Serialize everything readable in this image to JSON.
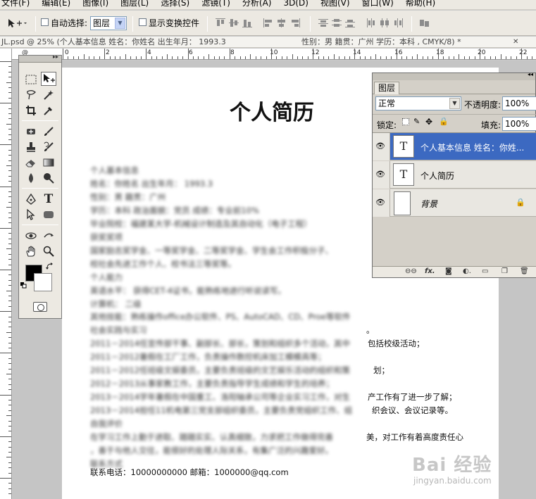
{
  "menu": [
    "文件(F)",
    "编辑(E)",
    "图像(I)",
    "图层(L)",
    "选择(S)",
    "滤镜(T)",
    "分析(A)",
    "3D(D)",
    "视图(V)",
    "窗口(W)",
    "帮助(H)"
  ],
  "options": {
    "auto_select_label": "自动选择:",
    "auto_select_value": "图层",
    "show_transform_label": "显示变换控件"
  },
  "doc": {
    "title": "JL.psd @ 25% (个人基本信息 姓名：你姓名  出生年月： 1993.3",
    "title_mid": "性别：男     籍贯：广州  学历：本科 , CMYK/8) *",
    "close": "✕"
  },
  "ruler": {
    "top_numbers": [
      "0",
      "2",
      "4",
      "6",
      "8",
      "10",
      "12",
      "14",
      "16",
      "18",
      "20",
      "22"
    ],
    "top_at_label": "@"
  },
  "resume": {
    "title": "个人简历",
    "lines": [
      "个人基本信息",
      "姓名：你姓名  出生年月： 1993.3",
      "性别：男     籍贯：广州",
      "学历：本科    政治面貌：党员    成绩：专业前10%",
      "毕业院校：福建某大学-机械设计制造及其自动化（电子工程）",
      "获奖奖项",
      "国家励志奖学金、一等奖学金、二等奖学金、学生会工作积极分子、",
      "校社会先进工作个人、校书法三等奖等。",
      "个人能力",
      "英语水平：  获得CET-4证书，能熟练地进行听说读写。",
      "计算机：  二级",
      "其他技能：熟练操作office办公软件、PS、AutoCAD、CD、Proe等软件",
      "社会实践与实习",
      "2011－2014任宣传部干事、副部长、部长，策划和组织多个活动，其中",
      "2011－2012暑假在工厂工作，负责操作数控机床加工模模具等；",
      "2011－2012任班级文娱委员，主要负责班级的文艺娱乐活动的组织和策",
      "2012－2013从事家教工作，主要负责指导学生成绩和学生的培养；",
      "2013－2014学年暑假在中国重工、洛阳轴承公司等企业实习工作，对生",
      "2013－2014担任11机电第三党支部组织委员，主要负责党组织工作、组",
      "自我评价",
      "在学习工作上勤于进取、踏踏实实、认真细致，力求把工作做得完善",
      "，善于与他人交往，能很好的处理人际关系，有集广泛的兴趣爱好。",
      "联系方式"
    ],
    "line_tails": {
      "13": "。",
      "14": "包括校级活动；",
      "16": "划；",
      "18": "产工作有了进一步了解；",
      "19": "织会议、会议记录等。",
      "21": "美，对工作有着高度责任心"
    },
    "contact": "联系电话：10000000000   邮箱：1000000@qq.com"
  },
  "layers_panel": {
    "tab": "图层",
    "blend_mode": "正常",
    "opacity_label": "不透明度:",
    "opacity_value": "100%",
    "lock_label": "锁定:",
    "fill_label": "填充:",
    "fill_value": "100%",
    "layers": [
      {
        "name": "个人基本信息 姓名：你姓...",
        "type": "text",
        "thumb": "T",
        "selected": true
      },
      {
        "name": "个人简历",
        "type": "text",
        "thumb": "T",
        "selected": false
      },
      {
        "name": "背景",
        "type": "background",
        "thumb": "",
        "selected": false,
        "locked": true
      }
    ]
  },
  "watermark": {
    "main": "Bai 经验",
    "sub": "jingyan.baidu.com"
  }
}
